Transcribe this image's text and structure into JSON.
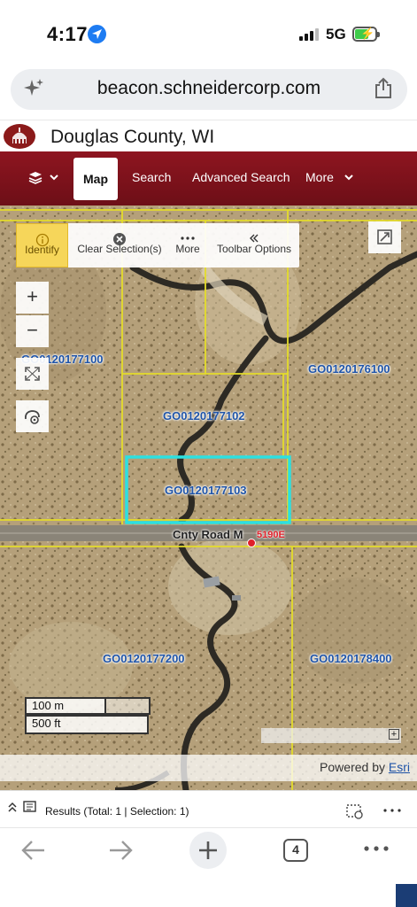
{
  "status_bar": {
    "time": "4:17",
    "network": "5G"
  },
  "browser": {
    "url": "beacon.schneidercorp.com",
    "tab_count": "4"
  },
  "site": {
    "county_title": "Douglas County, WI"
  },
  "nav": {
    "items": [
      {
        "label": "Map",
        "active": true
      },
      {
        "label": "Search"
      },
      {
        "label": "Advanced Search"
      },
      {
        "label": "More"
      }
    ]
  },
  "toolbar": {
    "identify": "Identify",
    "clear": "Clear Selection(s)",
    "more": "More",
    "options": "Toolbar Options"
  },
  "map_controls": {
    "zoom_in": "+",
    "zoom_out": "−"
  },
  "parcels": [
    {
      "id": "GO0120177100"
    },
    {
      "id": "GO0120176100"
    },
    {
      "id": "GO0120177102"
    },
    {
      "id": "GO0120177103",
      "selected": true
    },
    {
      "id": "GO0120177200"
    },
    {
      "id": "GO0120178400"
    }
  ],
  "road": {
    "name": "Cnty Road M",
    "address": "5190E"
  },
  "scale": {
    "metric": "100 m",
    "imperial": "500 ft"
  },
  "attribution": {
    "prefix": "Powered by ",
    "link": "Esri"
  },
  "results": {
    "summary": "Results (Total: 1 | Selection: 1)"
  },
  "colors": {
    "nav_brand": "#7d121b",
    "selection": "#2de0e0",
    "parcel_line": "#e4dc2a",
    "identify_active": "#f6d65a",
    "link": "#1f54a8"
  }
}
